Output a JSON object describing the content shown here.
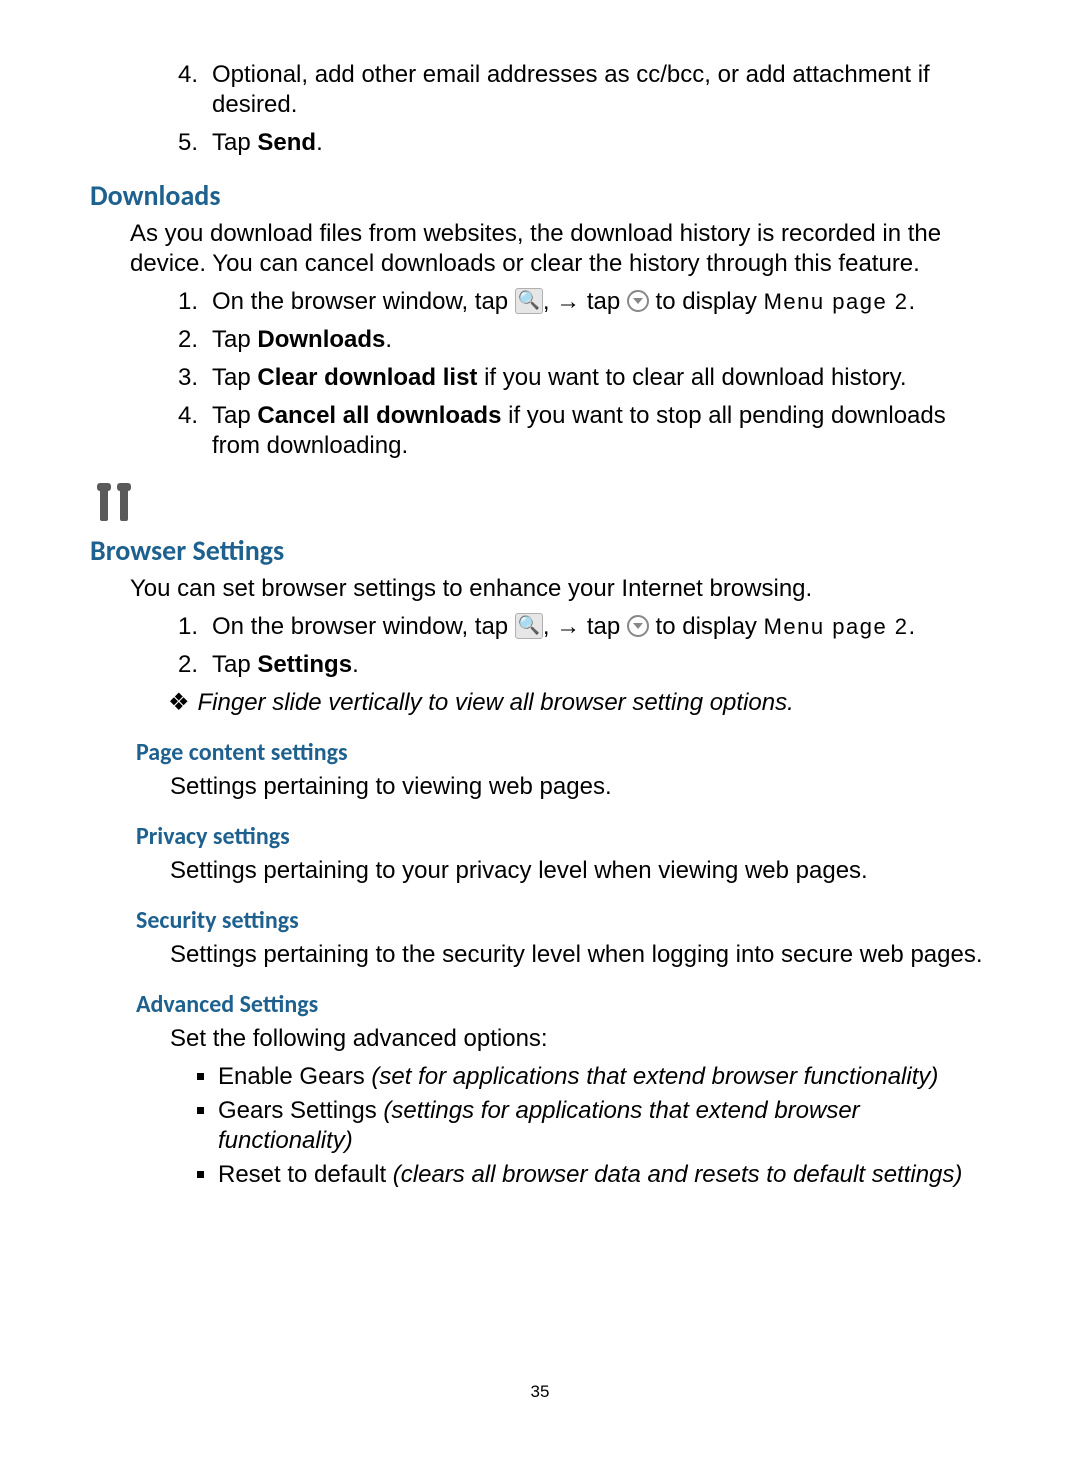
{
  "initial_list": {
    "start": 4,
    "items": [
      "Optional, add other email addresses as cc/bcc, or add attachment if desired.",
      {
        "pre": "Tap ",
        "bold": "Send",
        "post": "."
      }
    ]
  },
  "downloads": {
    "title": "Downloads",
    "intro": "As you download files from websites, the download history is recorded in the device. You can cancel downloads or clear the history through this feature.",
    "items": [
      {
        "pre": "On the browser window, tap ",
        "icon1": "menu-icon",
        "mid": ", → tap ",
        "icon2": "dropdown-circle-icon",
        "post": " to display ",
        "spaced": "Menu page 2",
        "tail": "."
      },
      {
        "pre": "Tap ",
        "bold": "Downloads",
        "post": "."
      },
      {
        "pre": "Tap ",
        "bold": "Clear download list",
        "post": " if you want to clear all download history."
      },
      {
        "pre": "Tap ",
        "bold": "Cancel all downloads",
        "post": " if you want to stop all pending downloads from downloading."
      }
    ]
  },
  "browser_settings": {
    "title": "Browser Settings",
    "intro": "You can set browser settings to enhance your Internet browsing.",
    "tip": "Finger slide vertically to view all browser setting options.",
    "items": [
      {
        "pre": "On the browser window, tap ",
        "icon1": "menu-icon",
        "mid": ", → tap ",
        "icon2": "dropdown-circle-icon",
        "post": " to display ",
        "spaced": "Menu page 2",
        "tail": "."
      },
      {
        "pre": "Tap ",
        "bold": "Settings",
        "post": "."
      }
    ],
    "groups": [
      {
        "title": "Page content settings",
        "desc": "Settings pertaining to viewing web pages."
      },
      {
        "title": "Privacy settings",
        "desc": "Settings pertaining to your privacy level when viewing web pages."
      },
      {
        "title": "Security settings",
        "desc": "Settings pertaining to the security level when logging into secure web pages."
      },
      {
        "title": "Advanced Settings",
        "desc": "Set the following advanced options:",
        "bullets": [
          {
            "lead": "Enable Gears ",
            "ital": "(set for applications that extend browser functionality)"
          },
          {
            "lead": "Gears Settings ",
            "ital": "(settings for applications that extend browser functionality)"
          },
          {
            "lead": "Reset to default ",
            "ital": "(clears all browser data and resets to default settings)"
          }
        ]
      }
    ]
  },
  "page_number": "35"
}
